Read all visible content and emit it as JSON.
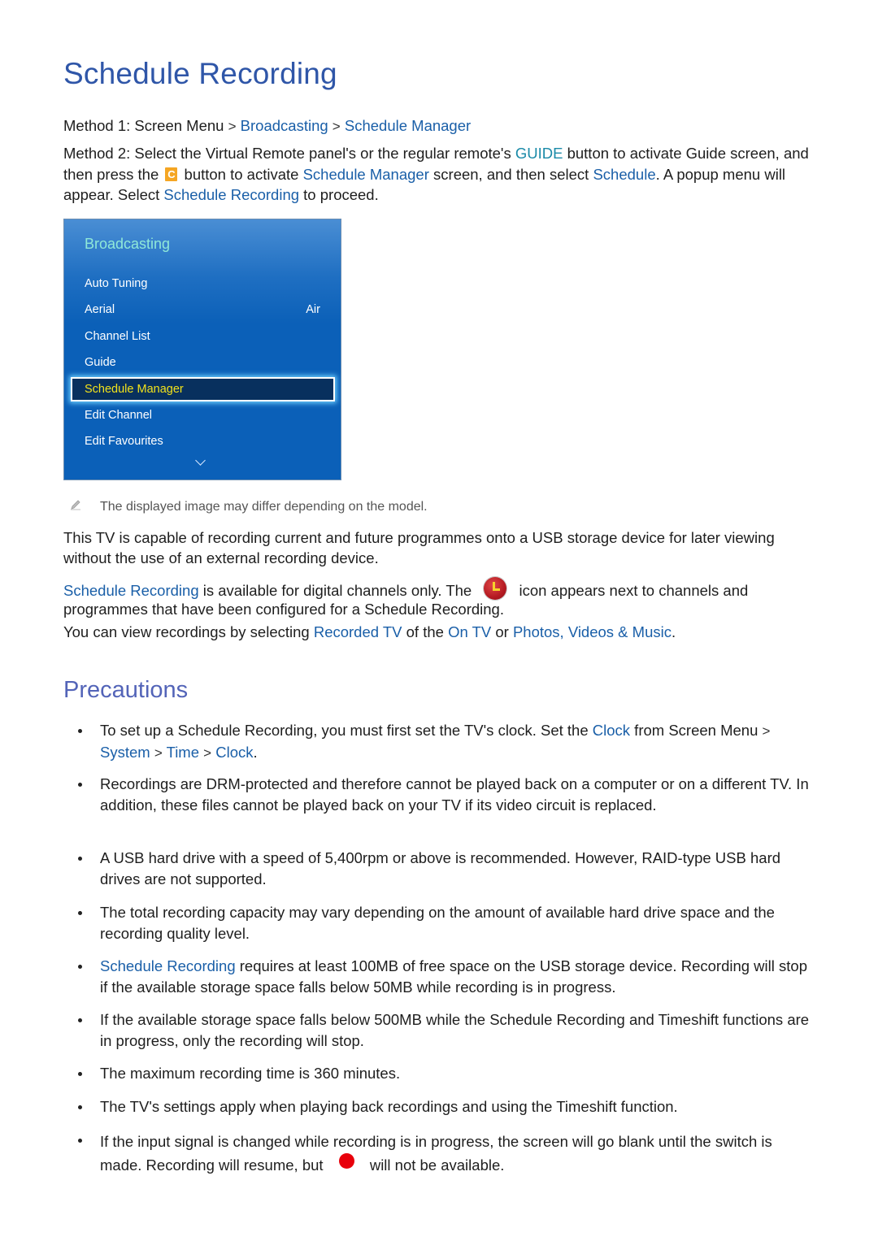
{
  "title": "Schedule Recording",
  "method1": {
    "label": "Method 1: Screen Menu",
    "sep": ">",
    "path": [
      "Broadcasting",
      "Schedule Manager"
    ]
  },
  "method2": {
    "label": "Method 2:",
    "t1": " Select the Virtual Remote panel's or the regular remote's ",
    "guide": "GUIDE",
    "t2": " button to activate Guide screen, and then press the ",
    "c_button": "C",
    "t3": " button to activate ",
    "link1": "Schedule Manager",
    "t4": " screen, and then select ",
    "link2": "Schedule",
    "t5": ". A popup menu will appear. Select ",
    "link3": "Schedule Recording",
    "t6": " to proceed."
  },
  "menu": {
    "title": "Broadcasting",
    "items": [
      {
        "label": "Auto Tuning",
        "value": ""
      },
      {
        "label": "Aerial",
        "value": "Air"
      },
      {
        "label": "Channel List",
        "value": ""
      },
      {
        "label": "Guide",
        "value": ""
      },
      {
        "label": "Schedule Manager",
        "value": "",
        "selected": true
      },
      {
        "label": "Edit Channel",
        "value": ""
      },
      {
        "label": "Edit Favourites",
        "value": ""
      }
    ],
    "more_icon": "chevron-down-icon"
  },
  "note": {
    "icon": "pencil-icon",
    "text": "The displayed image may differ depending on the model."
  },
  "para1": "This TV is capable of recording current and future programmes onto a USB storage device for later viewing without the use of an external recording device.",
  "para2": {
    "link": "Schedule Recording",
    "t1": " is available for digital channels only. The ",
    "icon": "schedule-recording-clock-icon",
    "t2": " icon appears next to channels and programmes that have been configured for a Schedule Recording."
  },
  "para3": {
    "t1": "You can view recordings by selecting ",
    "link1": "Recorded TV",
    "t2": " of the ",
    "link2": "On TV",
    "t3": " or ",
    "link3": "Photos, Videos & Music",
    "t4": "."
  },
  "precautions": {
    "title": "Precautions",
    "b1": {
      "t1": "To set up a Schedule Recording, you must first set the TV's clock. Set the ",
      "link1": "Clock",
      "t2": " from ",
      "menu": "Screen Menu",
      "sep": ">",
      "path": [
        "System",
        "Time",
        "Clock"
      ],
      "end": "."
    },
    "b2": "Recordings are DRM-protected and therefore cannot be played back on a computer or on a different TV. In addition, these files cannot be played back on your TV if its video circuit is replaced.",
    "b3": "A USB hard drive with a speed of 5,400rpm or above is recommended. However, RAID-type USB hard drives are not supported.",
    "b4": "The total recording capacity may vary depending on the amount of available hard drive space and the recording quality level.",
    "b5": {
      "link": "Schedule Recording",
      "text": " requires at least 100MB of free space on the USB storage device. Recording will stop if the available storage space falls below 50MB while recording is in progress."
    },
    "b6": "If the available storage space falls below 500MB while the Schedule Recording and Timeshift functions are in progress, only the recording will stop.",
    "b7": "The maximum recording time is 360 minutes.",
    "b8": "The TV's settings apply when playing back recordings and using the Timeshift function.",
    "b9": {
      "t1": "If the input signal is changed while recording is in progress, the screen will go blank until the switch is made. Recording will resume, but ",
      "icon": "record-dot-icon",
      "t2": " will not be available."
    }
  },
  "colors": {
    "heading": "#2f56a8",
    "subheading": "#5364b8",
    "link": "#1a5fa8",
    "menu_bg": "#0b60b8",
    "menu_title": "#8fe8d8",
    "menu_selected_text": "#f2e21a",
    "record_dot": "#e8000b",
    "c_button": "#f5a623"
  }
}
